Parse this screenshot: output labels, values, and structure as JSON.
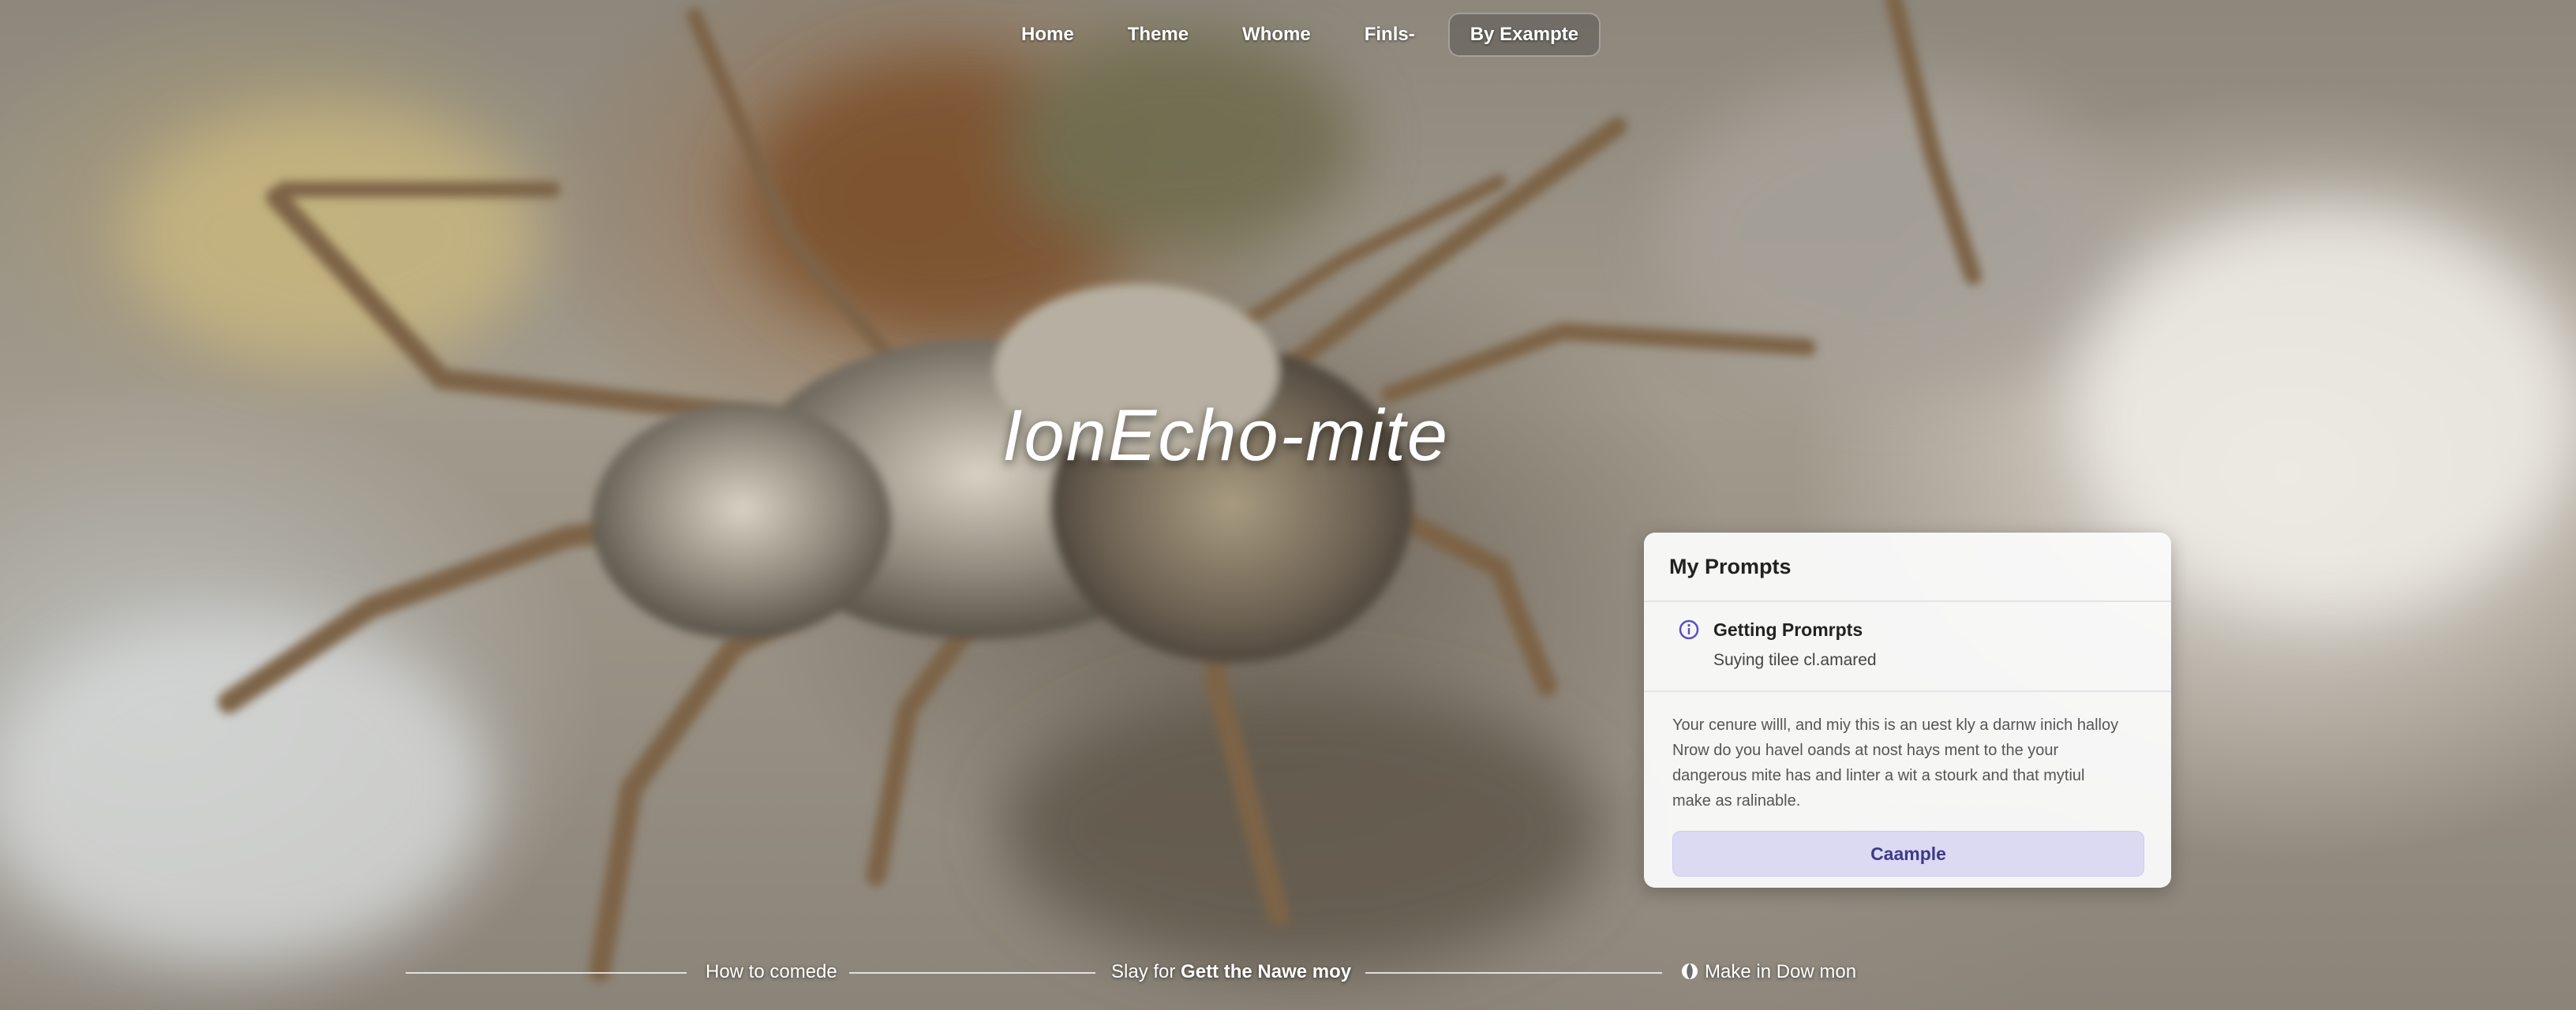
{
  "nav": {
    "items": [
      "Home",
      "Theme",
      "Whome",
      "Finls-"
    ],
    "pill_label": "By  Exampte"
  },
  "hero": {
    "title": "IonEcho-mite"
  },
  "prompts_panel": {
    "title": "My Prompts",
    "item": {
      "icon": "info-icon",
      "title": "Getting Promrpts",
      "subtitle": "Suying tilee cl.amared"
    },
    "body_lines": [
      "Your cenure willl, and miy this is an uest kly a darnw inich halloy",
      "Nrow do you havel oands at nost hays ment to the your",
      "dangerous mite has and linter a wit a stourk and that mytiul",
      "make as ralinable."
    ],
    "button_label": "Caample",
    "accent_color": "#5b4fc4"
  },
  "bottom": {
    "link1": "How to comede",
    "link2_prefix": "Slay for",
    "link2_bold": "Gett the Nawe moy",
    "link3_icon": "globe-icon",
    "link3": "Make in Dow mon"
  }
}
